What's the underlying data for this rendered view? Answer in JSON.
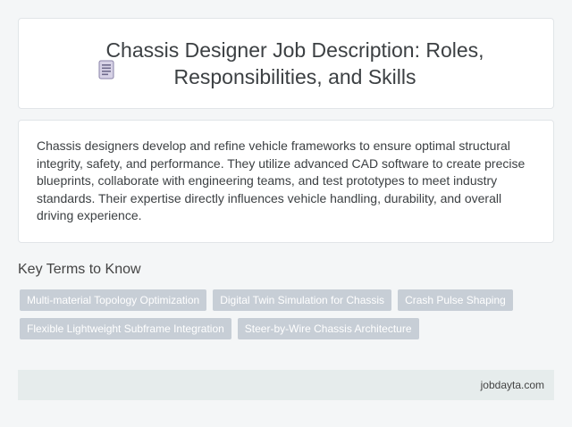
{
  "header": {
    "icon": "document-icon",
    "title": "Chassis Designer Job Description: Roles, Responsibilities, and Skills"
  },
  "description": "Chassis designers develop and refine vehicle frameworks to ensure optimal structural integrity, safety, and performance. They utilize advanced CAD software to create precise blueprints, collaborate with engineering teams, and test prototypes to meet industry standards. Their expertise directly influences vehicle handling, durability, and overall driving experience.",
  "key_terms": {
    "heading": "Key Terms to Know",
    "tags": [
      "Multi-material Topology Optimization",
      "Digital Twin Simulation for Chassis",
      "Crash Pulse Shaping",
      "Flexible Lightweight Subframe Integration",
      "Steer-by-Wire Chassis Architecture"
    ]
  },
  "footer": {
    "site": "jobdayta.com"
  },
  "colors": {
    "background": "#f4f6f7",
    "tag_bg": "#c7ced6",
    "footer_bg": "#e6ecec"
  }
}
